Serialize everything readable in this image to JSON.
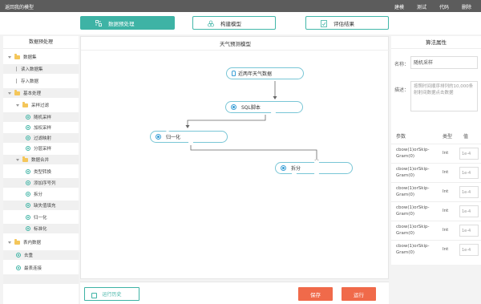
{
  "topbar": {
    "back_label": "返回我的模型",
    "menu": [
      "建模",
      "测试",
      "代码",
      "删除"
    ]
  },
  "steps": [
    {
      "label": "数据预处理",
      "active": true
    },
    {
      "label": "构建模型",
      "active": false
    },
    {
      "label": "评估结果",
      "active": false
    }
  ],
  "sidebar": {
    "title": "数据预处理",
    "items": [
      {
        "label": "数据集",
        "level": 0,
        "kind": "folder"
      },
      {
        "label": "读入数据集",
        "level": 1,
        "kind": "leaf"
      },
      {
        "label": "存入数据",
        "level": 1,
        "kind": "leaf"
      },
      {
        "label": "基本处理",
        "level": 0,
        "kind": "folder"
      },
      {
        "label": "采样过滤",
        "level": 1,
        "kind": "folder"
      },
      {
        "label": "随机采样",
        "level": 2,
        "kind": "op"
      },
      {
        "label": "加权采样",
        "level": 2,
        "kind": "op"
      },
      {
        "label": "过滤映射",
        "level": 2,
        "kind": "op"
      },
      {
        "label": "分层采样",
        "level": 2,
        "kind": "op"
      },
      {
        "label": "数据合并",
        "level": 1,
        "kind": "folder"
      },
      {
        "label": "类型转换",
        "level": 2,
        "kind": "op"
      },
      {
        "label": "添加序号列",
        "level": 2,
        "kind": "op"
      },
      {
        "label": "拆分",
        "level": 2,
        "kind": "op"
      },
      {
        "label": "缺失值填充",
        "level": 2,
        "kind": "op"
      },
      {
        "label": "归一化",
        "level": 2,
        "kind": "op"
      },
      {
        "label": "标准化",
        "level": 2,
        "kind": "op"
      },
      {
        "label": "表内数据",
        "level": 0,
        "kind": "folder"
      },
      {
        "label": "去重",
        "level": 1,
        "kind": "op"
      },
      {
        "label": "最表连接",
        "level": 1,
        "kind": "op"
      }
    ]
  },
  "canvas": {
    "title": "天气预测模型",
    "nodes": {
      "data": "近两年天气数据",
      "sql": "SQL脚本",
      "normalize": "归一化",
      "split": "拆分"
    }
  },
  "bottom": {
    "history_label": "运行历史",
    "save_label": "保存",
    "run_label": "运行"
  },
  "props": {
    "title": "算法属性",
    "name_label": "名称：",
    "name_value": "随机采样",
    "desc_label": "描述：",
    "desc_value": "按照时间顺序排列的10,000条射射间数据点击数据",
    "columns": [
      "参数",
      "类型",
      "值"
    ],
    "rows": [
      {
        "name": "cbow(1)orSkip-Gram(0)",
        "type": "Int",
        "value": "1e-4"
      },
      {
        "name": "cbow(1)orSkip-Gram(0)",
        "type": "Int",
        "value": "1e-4"
      },
      {
        "name": "cbow(1)orSkip-Gram(0)",
        "type": "Int",
        "value": "1e-4"
      },
      {
        "name": "cbow(1)orSkip-Gram(0)",
        "type": "Int",
        "value": "1e-4"
      },
      {
        "name": "cbow(1)orSkip-Gram(0)",
        "type": "Int",
        "value": "1e-4"
      },
      {
        "name": "cbow(1)orSkip-Gram(0)",
        "type": "Int",
        "value": "1e-4"
      }
    ]
  },
  "colors": {
    "accent": "#3eb3a5",
    "danger": "#f06a4a",
    "topbar": "#5c5c5c"
  }
}
